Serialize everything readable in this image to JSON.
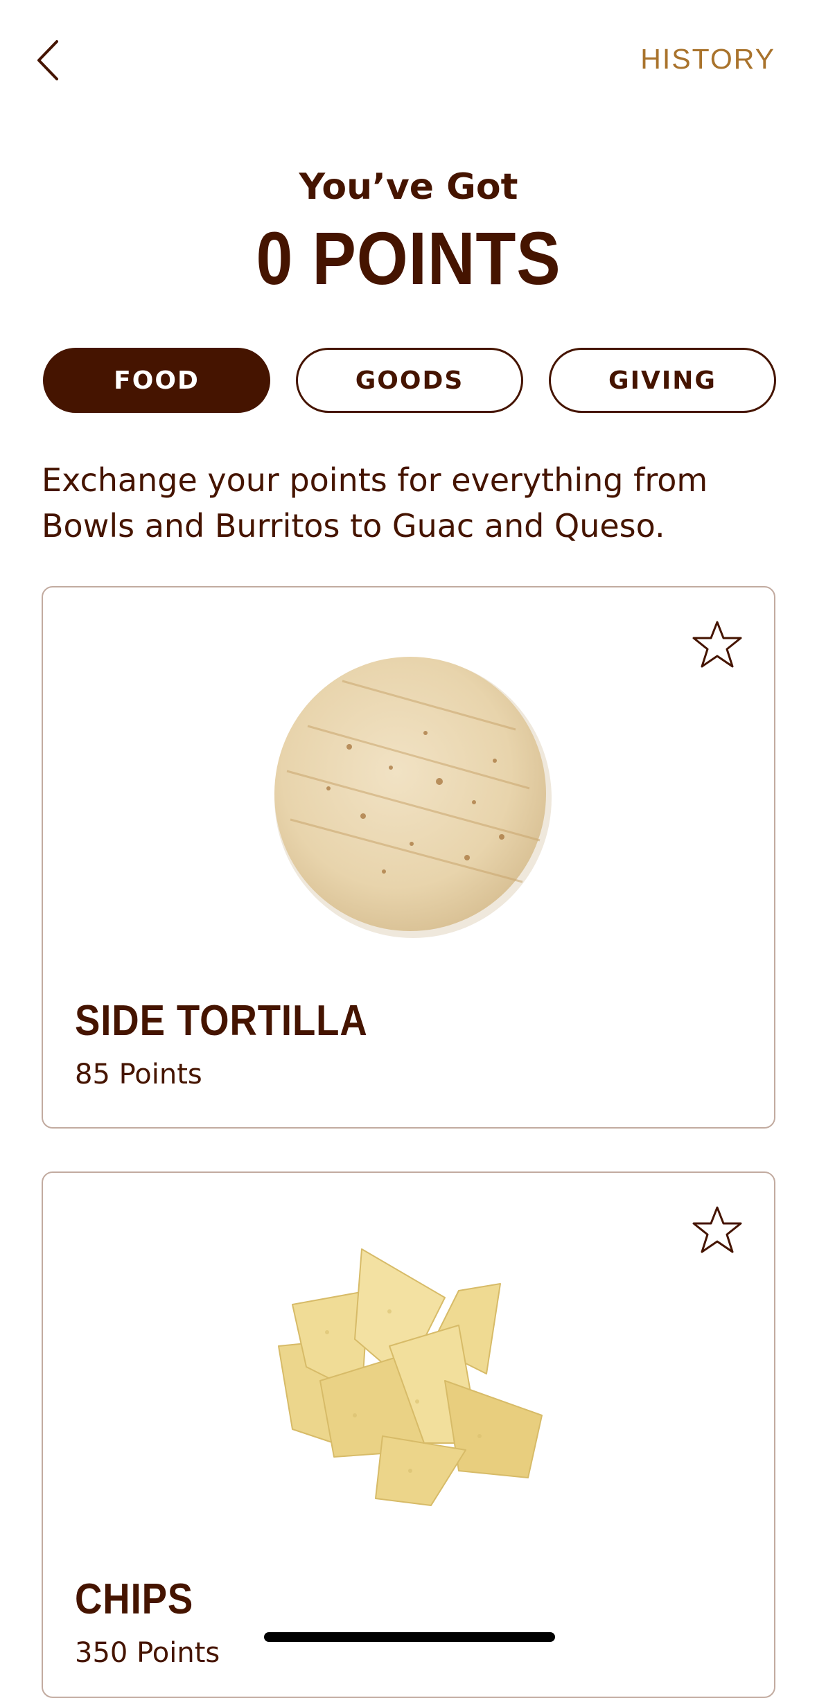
{
  "header": {
    "history_label": "HISTORY"
  },
  "summary": {
    "subtitle": "You’ve Got",
    "points_label": "0 POINTS"
  },
  "tabs": [
    {
      "label": "FOOD",
      "active": true
    },
    {
      "label": "GOODS",
      "active": false
    },
    {
      "label": "GIVING",
      "active": false
    }
  ],
  "description": "Exchange your points for everything from Bowls and Burritos to Guac and Queso.",
  "rewards": [
    {
      "name": "SIDE TORTILLA",
      "points": "85 Points",
      "image": "tortilla-image"
    },
    {
      "name": "CHIPS",
      "points": "350 Points",
      "image": "chips-image"
    }
  ],
  "colors": {
    "brand_brown": "#451400",
    "accent_gold": "#a9732c",
    "card_border": "#c2aba0"
  }
}
